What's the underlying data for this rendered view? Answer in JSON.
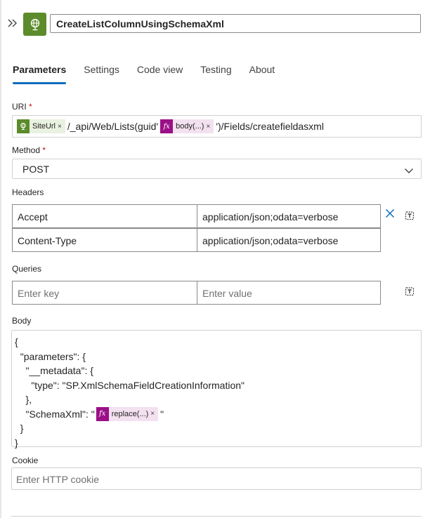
{
  "header": {
    "title": "CreateListColumnUsingSchemaXml",
    "action_icon": "globe-icon",
    "accent": "#5c8b2b"
  },
  "tabs": [
    {
      "label": "Parameters",
      "active": true
    },
    {
      "label": "Settings",
      "active": false
    },
    {
      "label": "Code view",
      "active": false
    },
    {
      "label": "Testing",
      "active": false
    },
    {
      "label": "About",
      "active": false
    }
  ],
  "uri": {
    "label": "URI",
    "required_mark": "*",
    "token1": "SiteUrl",
    "text1": "/_api/Web/Lists(guid'",
    "token2": "body(...)",
    "text2": "')/Fields/createfieldasxml",
    "token_remove": "×",
    "fx_glyph": "fx"
  },
  "method": {
    "label": "Method",
    "required_mark": "*",
    "value": "POST"
  },
  "headers": {
    "label": "Headers",
    "rows": [
      {
        "key": "Accept",
        "value": "application/json;odata=verbose"
      },
      {
        "key": "Content-Type",
        "value": "application/json;odata=verbose"
      }
    ]
  },
  "queries": {
    "label": "Queries",
    "key_placeholder": "Enter key",
    "value_placeholder": "Enter value"
  },
  "body": {
    "label": "Body",
    "lines": [
      "{",
      "  \"parameters\": {",
      "    \"__metadata\": {",
      "      \"type\": \"SP.XmlSchemaFieldCreationInformation\"",
      "    },",
      "    \"SchemaXml\": \"",
      "  }",
      "}"
    ],
    "token": "replace(...)",
    "after_token": "\""
  },
  "cookie": {
    "label": "Cookie",
    "placeholder": "Enter HTTP cookie"
  },
  "colors": {
    "tab_underline": "#0f6cbd",
    "required": "#c50f1f",
    "expression_token": "#9b0f87",
    "delete_icon": "#0f6cbd"
  }
}
